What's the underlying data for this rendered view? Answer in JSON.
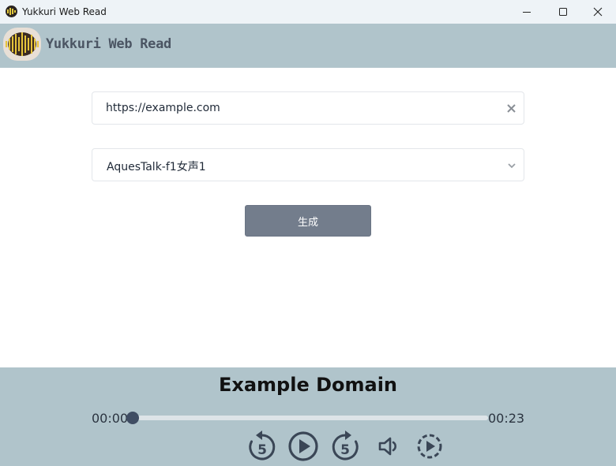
{
  "window": {
    "title": "Yukkuri Web Read"
  },
  "header": {
    "brand": "Yukkuri Web Read"
  },
  "form": {
    "url_value": "https://example.com",
    "voice_selected": "AquesTalk-f1女声1",
    "generate_label": "生成"
  },
  "player": {
    "title": "Example Domain",
    "current_time": "00:00",
    "total_time": "00:23",
    "progress": 0,
    "skip_back_seconds": "5",
    "skip_forward_seconds": "5"
  },
  "colors": {
    "header_bg": "#b0c4cb",
    "button_bg": "#737d8c",
    "seek_thumb": "#3f4d63",
    "icon_dark": "#3a4656"
  },
  "icons": {
    "app": "waveform-icon",
    "clear": "close-icon",
    "select": "chevron-down-icon",
    "rewind": "replay-5-icon",
    "play": "play-circle-icon",
    "forward": "forward-5-icon",
    "volume": "volume-icon",
    "speed": "playback-speed-icon"
  }
}
